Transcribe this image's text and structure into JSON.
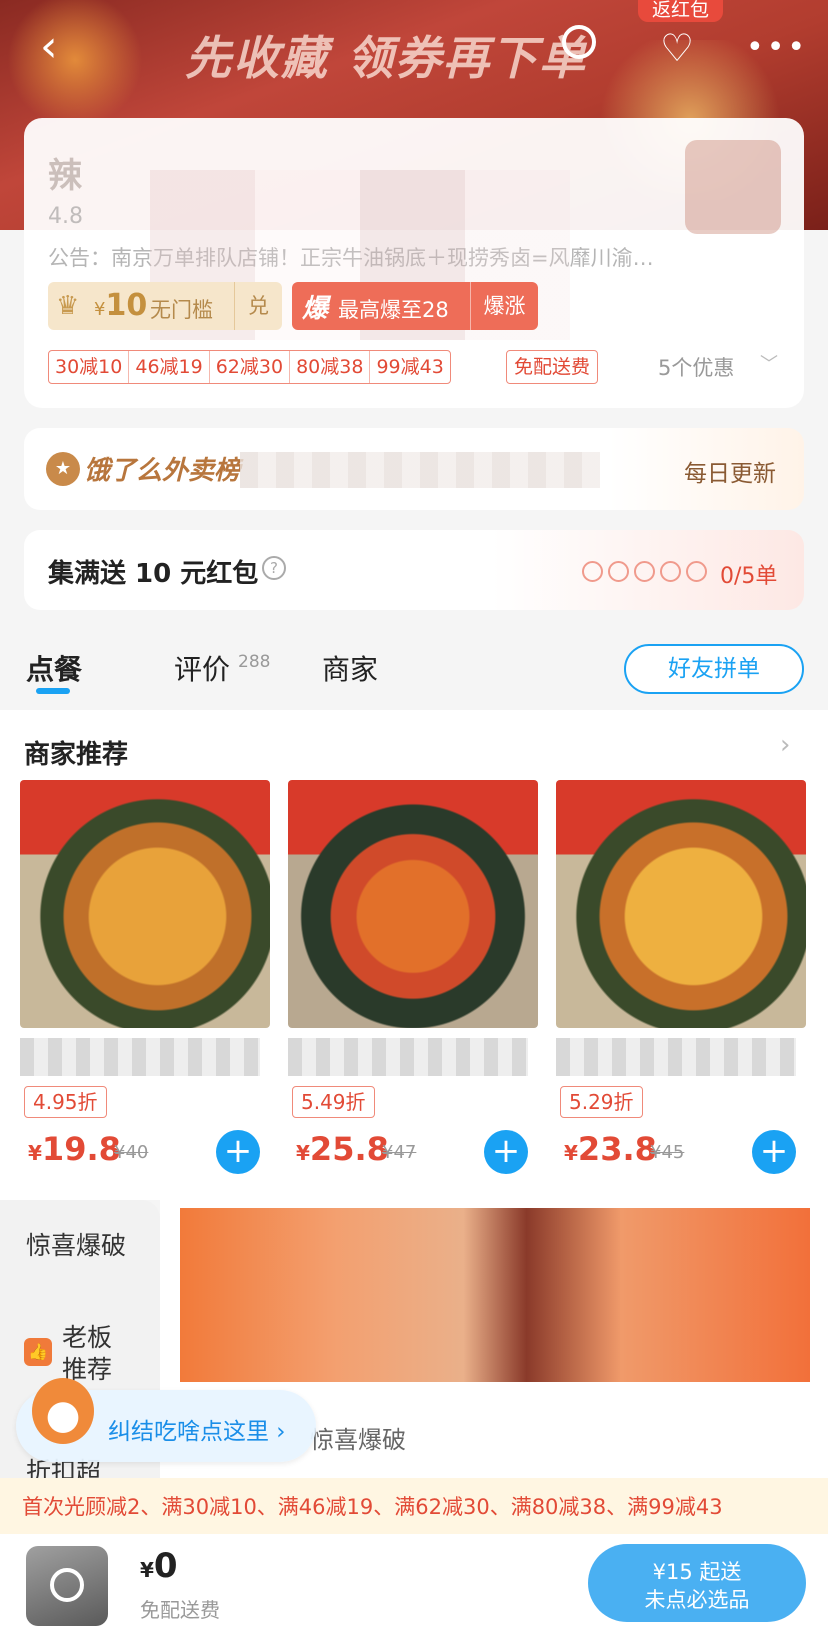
{
  "header": {
    "banner_text": "先收藏 领券再下单",
    "back_icon": "back-arrow-icon",
    "fanhongbao_label": "返红包",
    "more_label": "•••"
  },
  "shop": {
    "name_initial": "辣",
    "rating": "4.8",
    "notice": "公告：南京万单排队店铺！正宗牛油锅底＋现捞秀卤=风靡川渝…",
    "coupon": {
      "currency": "¥",
      "amount": "10",
      "desc": "无门槛",
      "exchange": "兑"
    },
    "baozhang": {
      "icon": "爆",
      "text": "最高爆至28",
      "tag": "爆涨"
    },
    "discounts": [
      "30减10",
      "46减19",
      "62减30",
      "80减38",
      "99减43"
    ],
    "free_delivery": "免配送费",
    "promo_count": "5个优惠"
  },
  "ranking": {
    "title": "饿了么外卖榜",
    "update": "每日更新"
  },
  "collect": {
    "title": "集满送 10 元红包",
    "help": "?",
    "progress": "0/5单",
    "filled": 0,
    "total": 5
  },
  "tabs": [
    {
      "label": "点餐",
      "active": true
    },
    {
      "label": "评价",
      "count": "288"
    },
    {
      "label": "商家"
    }
  ],
  "pin_label": "好友拼单",
  "recommend": {
    "title": "商家推荐",
    "items": [
      {
        "discount": "4.95折",
        "currency": "¥",
        "price": "19.8",
        "original": "¥40"
      },
      {
        "discount": "5.49折",
        "currency": "¥",
        "price": "25.8",
        "original": "¥47"
      },
      {
        "discount": "5.29折",
        "currency": "¥",
        "price": "23.8",
        "original": "¥45"
      }
    ]
  },
  "menu": {
    "categories": [
      "惊喜爆破",
      "老板推荐",
      "折扣超"
    ],
    "section_label": "惊喜爆破"
  },
  "floater": {
    "text": "纠结吃啥点这里 ›"
  },
  "promo_strip": "首次光顾减2、满30减10、满46减19、满62减30、满80减38、满99减43",
  "bottom": {
    "currency": "¥",
    "total": "0",
    "delivery": "免配送费",
    "checkout_line1": "¥15 起送",
    "checkout_line2": "未点必选品"
  }
}
